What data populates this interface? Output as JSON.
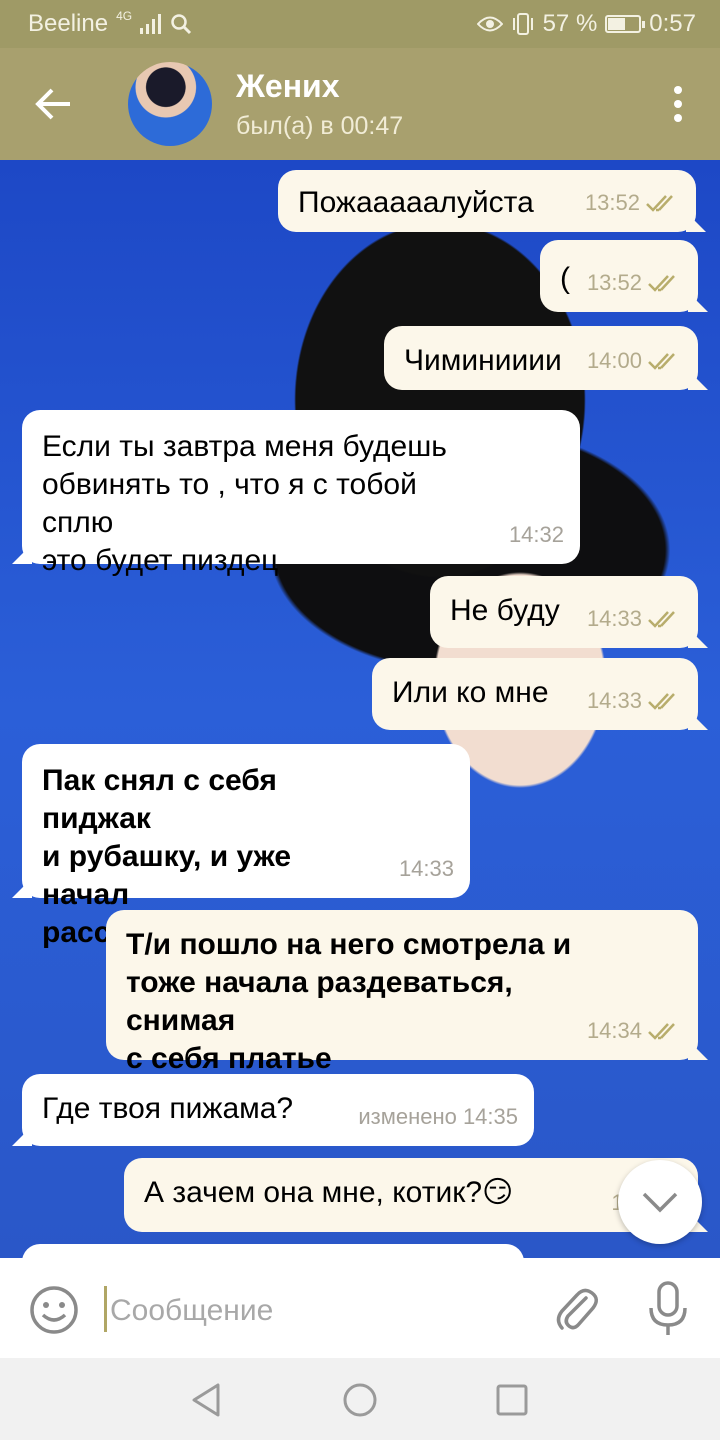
{
  "status_bar": {
    "carrier": "Beeline",
    "network": "4G",
    "battery": "57 %",
    "battery_level": 0.57,
    "time": "0:57"
  },
  "header": {
    "contact_name": "Жених",
    "last_seen": "был(а) в 00:47"
  },
  "messages": [
    {
      "dir": "out",
      "text": "Пожааааалуйста",
      "time": "13:52"
    },
    {
      "dir": "out",
      "text": "(",
      "time": "13:52"
    },
    {
      "dir": "out",
      "text": "Чиминииии",
      "time": "14:00"
    },
    {
      "dir": "in",
      "text": "Если ты завтра меня будешь\nобвинять то , что я с тобой сплю\nэто будет пиздец",
      "time": "14:32"
    },
    {
      "dir": "out",
      "text": "Не буду",
      "time": "14:33"
    },
    {
      "dir": "out",
      "text": "Или ко мне",
      "time": "14:33"
    },
    {
      "dir": "in",
      "text": "Пак снял с себя пиджак\nи рубашку, и уже начал\nрасстегивать ремень",
      "time": "14:33",
      "bold": true
    },
    {
      "dir": "out",
      "text": "Т/и пошло на него смотрела и\nтоже начала раздеваться, снимая\nс себя платье",
      "time": "14:34",
      "bold": true
    },
    {
      "dir": "in",
      "text": "Где твоя пижама?",
      "time": "изменено 14:35"
    },
    {
      "dir": "out",
      "text": "А зачем она мне, котик?😏",
      "time": "14:"
    }
  ],
  "composer": {
    "placeholder": "Сообщение"
  },
  "colors": {
    "header": "#a8a06e",
    "status_bar": "#9f9a66",
    "outgoing_bubble": "#fcf7ea",
    "incoming_bubble": "#ffffff",
    "checks": "#b8ad6c"
  },
  "icons": [
    "back-arrow-icon",
    "more-vert-icon",
    "double-check-icon",
    "chevron-down-icon",
    "emoji-icon",
    "attach-icon",
    "mic-icon",
    "nav-back-icon",
    "nav-home-icon",
    "nav-recents-icon"
  ]
}
